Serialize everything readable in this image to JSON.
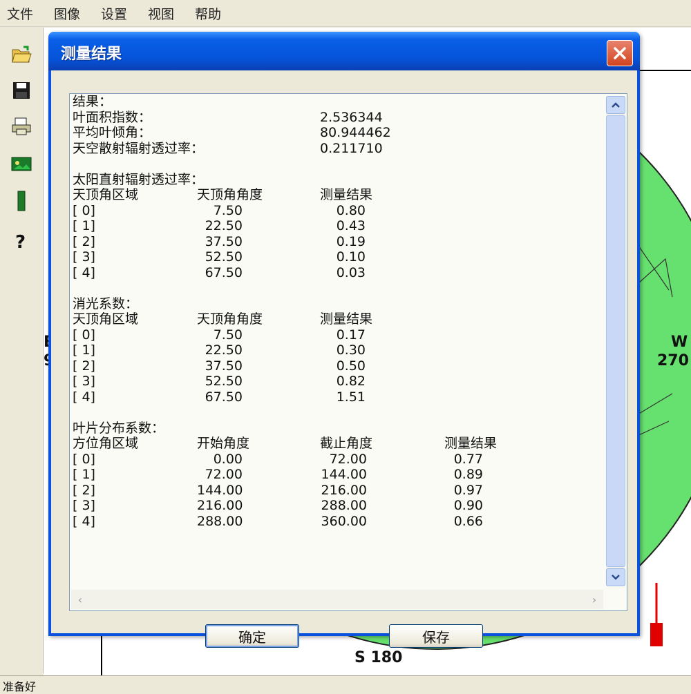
{
  "menu": [
    "文件",
    "图像",
    "设置",
    "视图",
    "帮助"
  ],
  "toolbar_icons": [
    "open-folder-icon",
    "save-disk-icon",
    "print-icon",
    "image-icon",
    "bar-icon",
    "help-icon"
  ],
  "compass": {
    "west": "W",
    "west_deg": "270",
    "south": "S 180",
    "east_partial": "E",
    "east_deg_partial": "9"
  },
  "status": "准备好",
  "dialog": {
    "title": "测量结果",
    "ok_label": "确定",
    "save_label": "保存"
  },
  "results": {
    "heading": "结果：",
    "lai_label": "叶面积指数：",
    "lai_value": "2.536344",
    "mta_label": "平均叶倾角：",
    "mta_value": "80.944462",
    "diffuse_label": "天空散射辐射透过率：",
    "diffuse_value": "0.211710",
    "direct_title": "太阳直射辐射透过率：",
    "direct_headers": [
      "天顶角区域",
      "天顶角角度",
      "测量结果"
    ],
    "direct_rows": [
      [
        "[ 0]",
        "7.50",
        "0.80"
      ],
      [
        "[ 1]",
        "22.50",
        "0.43"
      ],
      [
        "[ 2]",
        "37.50",
        "0.19"
      ],
      [
        "[ 3]",
        "52.50",
        "0.10"
      ],
      [
        "[ 4]",
        "67.50",
        "0.03"
      ]
    ],
    "extinction_title": "消光系数：",
    "extinction_headers": [
      "天顶角区域",
      "天顶角角度",
      "测量结果"
    ],
    "extinction_rows": [
      [
        "[ 0]",
        "7.50",
        "0.17"
      ],
      [
        "[ 1]",
        "22.50",
        "0.30"
      ],
      [
        "[ 2]",
        "37.50",
        "0.50"
      ],
      [
        "[ 3]",
        "52.50",
        "0.82"
      ],
      [
        "[ 4]",
        "67.50",
        "1.51"
      ]
    ],
    "leafdist_title": "叶片分布系数：",
    "leafdist_headers": [
      "方位角区域",
      "开始角度",
      "截止角度",
      "测量结果"
    ],
    "leafdist_rows": [
      [
        "[ 0]",
        "0.00",
        "72.00",
        "0.77"
      ],
      [
        "[ 1]",
        "72.00",
        "144.00",
        "0.89"
      ],
      [
        "[ 2]",
        "144.00",
        "216.00",
        "0.97"
      ],
      [
        "[ 3]",
        "216.00",
        "288.00",
        "0.90"
      ],
      [
        "[ 4]",
        "288.00",
        "360.00",
        "0.66"
      ]
    ]
  },
  "colors": {
    "canopy_green": "#66e06e",
    "title_blue": "#0553d9",
    "close_red": "#d2441f",
    "marker_red": "#e00000"
  }
}
